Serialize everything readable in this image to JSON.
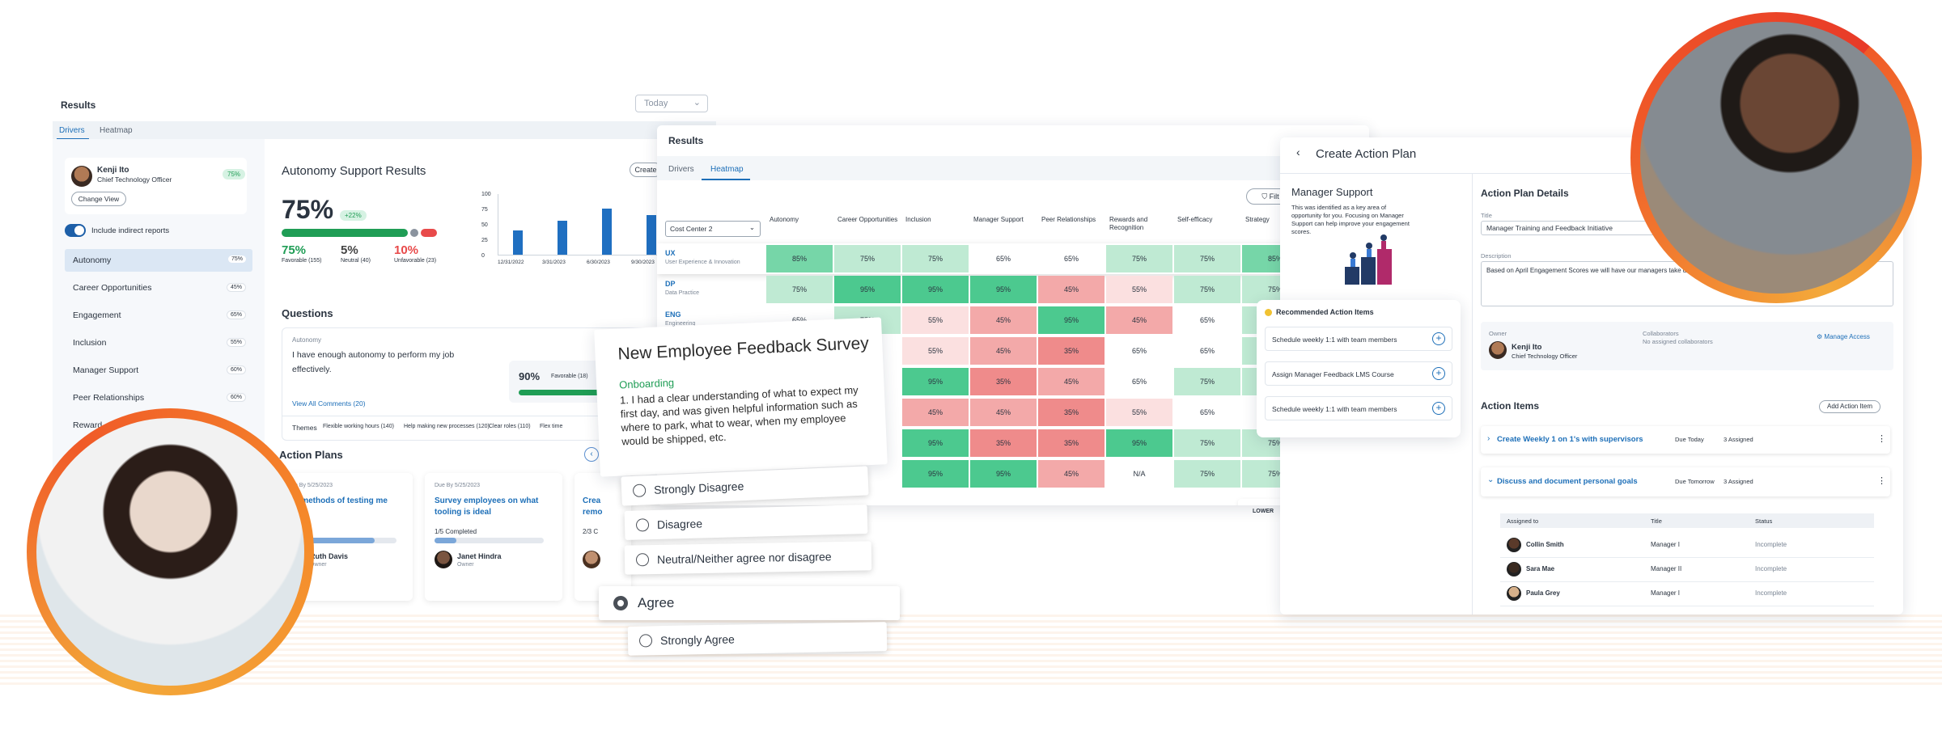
{
  "left": {
    "title": "Results",
    "date_select": "Today",
    "tabs": [
      "Drivers",
      "Heatmap"
    ],
    "person": {
      "name": "Kenji Ito",
      "role": "Chief Technology Officer",
      "score": "75%",
      "change_view": "Change View"
    },
    "include_indirect": "Include indirect reports",
    "drivers": [
      {
        "label": "Autonomy",
        "score": "75%"
      },
      {
        "label": "Career Opportunities",
        "score": "45%"
      },
      {
        "label": "Engagement",
        "score": "65%"
      },
      {
        "label": "Inclusion",
        "score": "55%"
      },
      {
        "label": "Manager Support",
        "score": "60%"
      },
      {
        "label": "Peer Relationships",
        "score": "60%"
      },
      {
        "label": "Reward",
        "score": ""
      }
    ],
    "support": {
      "title": "Autonomy Support Results",
      "create_btn": "Create",
      "big": "75%",
      "delta": "+22%",
      "fav": "75%",
      "fav_label": "Favorable (155)",
      "neu": "5%",
      "neu_label": "Neutral (40)",
      "unf": "10%",
      "unf_label": "Unfavorable (23)"
    },
    "chart_data": {
      "type": "bar",
      "categories": [
        "12/31/2022",
        "3/31/2023",
        "6/30/2023",
        "9/30/2023"
      ],
      "values": [
        40,
        55,
        75,
        65
      ],
      "yticks": [
        "100",
        "75",
        "50",
        "25",
        "0"
      ],
      "ylim": [
        0,
        100
      ]
    },
    "questions": {
      "title": "Questions",
      "category": "Autonomy",
      "text": "I have enough autonomy to perform my job effectively.",
      "score": "90%",
      "score_label": "Favorable (18)",
      "view_all": "View All Comments (20)",
      "themes_label": "Themes",
      "themes": [
        "Flexible working hours (140)",
        "Help making new processes (120)",
        "Clear roles (110)",
        "Flex time"
      ]
    },
    "action_plans": {
      "title": "Action Plans",
      "cards": [
        {
          "due": "Due By  5/25/2023",
          "title": "ate methods of testing me",
          "completed": "pleted",
          "owner": "Ruth Davis",
          "owner_role": "Owner"
        },
        {
          "due": "Due By  5/25/2023",
          "title": "Survey employees on what tooling is ideal",
          "completed": "1/5 Completed",
          "owner": "Janet Hindra",
          "owner_role": "Owner"
        },
        {
          "due": "",
          "title": "Crea remo",
          "completed": "2/3 C",
          "owner": "",
          "owner_role": ""
        }
      ]
    }
  },
  "heatmap": {
    "title": "Results",
    "tabs": [
      "Drivers",
      "Heatmap"
    ],
    "filter_btn": "Filt",
    "select": "Cost Center 2",
    "columns": [
      "Autonomy",
      "Career Opportunities",
      "Inclusion",
      "Manager Support",
      "Peer Relationships",
      "Rewards and Recognition",
      "Self-efficacy",
      "Strategy"
    ],
    "rows": [
      {
        "code": "UX",
        "name": "User Experience & Innovation",
        "values": [
          "85%",
          "75%",
          "75%",
          "65%",
          "65%",
          "75%",
          "75%",
          "85%"
        ]
      },
      {
        "code": "DP",
        "name": "Data Practice",
        "values": [
          "75%",
          "95%",
          "95%",
          "95%",
          "45%",
          "55%",
          "75%",
          "75%"
        ]
      },
      {
        "code": "ENG",
        "name": "Engineering",
        "values": [
          "65%",
          "75%",
          "55%",
          "45%",
          "95%",
          "45%",
          "65%",
          "75%"
        ]
      },
      {
        "code": "",
        "name": "",
        "values": [
          "",
          "",
          "55%",
          "45%",
          "35%",
          "65%",
          "65%",
          "75%"
        ]
      },
      {
        "code": "",
        "name": "",
        "values": [
          "",
          "",
          "95%",
          "35%",
          "45%",
          "65%",
          "75%",
          "75%"
        ]
      },
      {
        "code": "",
        "name": "",
        "values": [
          "",
          "",
          "45%",
          "45%",
          "35%",
          "55%",
          "65%",
          "65%"
        ]
      },
      {
        "code": "",
        "name": "",
        "values": [
          "",
          "",
          "95%",
          "35%",
          "35%",
          "95%",
          "75%",
          "75%"
        ]
      },
      {
        "code": "",
        "name": "",
        "values": [
          "",
          "",
          "95%",
          "95%",
          "45%",
          "N/A",
          "75%",
          "75%"
        ]
      }
    ],
    "legend_lower": "LOWER"
  },
  "survey": {
    "title": "New Employee Feedback Survey",
    "section": "Onboarding",
    "question": "1. I had a clear understanding of what to expect my first day, and was given helpful information such as where to park, what to wear, when my employee would be shipped, etc.",
    "options": [
      "Strongly Disagree",
      "Disagree",
      "Neutral/Neither agree nor disagree",
      "Agree",
      "Strongly Agree"
    ],
    "selected": "Agree"
  },
  "plan": {
    "title": "Create Action Plan",
    "focus_title": "Manager Support",
    "focus_text": "This was identified as a key area of opportunity for you. Focusing on Manager Support can help improve your engagement scores.",
    "recommended_title": "Recommended Action Items",
    "recommended": [
      "Schedule weekly 1:1 with team members",
      "Assign Manager Feedback LMS Course",
      "Schedule weekly 1:1 with team members"
    ],
    "details_title": "Action Plan Details",
    "title_label": "Title",
    "title_value": "Manager Training and Feedback Initiative",
    "desc_label": "Description",
    "desc_value": "Based on April Engagement Scores we will have our managers take discuss our progress.",
    "owner_label": "Owner",
    "owner_name": "Kenji Ito",
    "owner_role": "Chief Technology Officer",
    "collab_label": "Collaborators",
    "collab_value": "No assigned collaborators",
    "manage_access": "Manage Access",
    "items_title": "Action Items",
    "add_item": "Add Action Item",
    "items": [
      {
        "title": "Create Weekly 1 on 1's with supervisors",
        "due": "Due Today",
        "assigned": "3 Assigned"
      },
      {
        "title": "Discuss and document personal goals",
        "due": "Due Tomorrow",
        "assigned": "3 Assigned"
      }
    ],
    "table_headers": [
      "Assigned to",
      "Title",
      "Status"
    ],
    "table_rows": [
      {
        "name": "Collin Smith",
        "title": "Manager I",
        "status": "Incomplete"
      },
      {
        "name": "Sara Mae",
        "title": "Manager II",
        "status": "Incomplete"
      },
      {
        "name": "Paula Grey",
        "title": "Manager I",
        "status": "Incomplete"
      }
    ]
  },
  "colors": {
    "accent": "#1d6fb8",
    "ring": "#f0612a",
    "green_hi": "#4cc98f",
    "green_lo": "#d9f3e6",
    "red_hi": "#f08b8b",
    "red_lo": "#fbe0e0"
  }
}
